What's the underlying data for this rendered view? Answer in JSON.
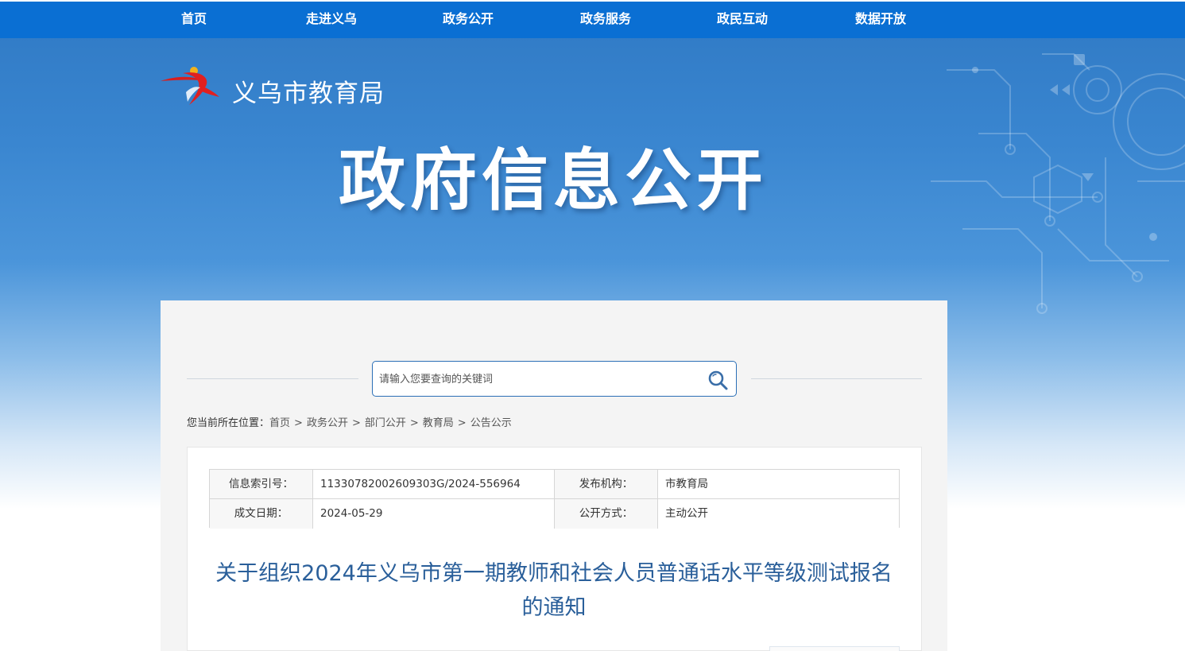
{
  "nav": {
    "items": [
      "首页",
      "走进义乌",
      "政务公开",
      "政务服务",
      "政民互动",
      "数据开放"
    ]
  },
  "header": {
    "logo_text": "义乌市教育局",
    "banner_title": "政府信息公开"
  },
  "search": {
    "placeholder": "请输入您要查询的关键词"
  },
  "breadcrumb": {
    "prefix": "您当前所在位置：",
    "items": [
      "首页",
      "政务公开",
      "部门公开",
      "教育局",
      "公告公示"
    ],
    "separator": ">"
  },
  "meta": {
    "index_label": "信息索引号：",
    "index_value": "11330782002609303G/2024-556964",
    "publisher_label": "发布机构：",
    "publisher_value": "市教育局",
    "date_label": "成文日期：",
    "date_value": "2024-05-29",
    "mode_label": "公开方式：",
    "mode_value": "主动公开"
  },
  "document": {
    "title": "关于组织2024年义乌市第一期教师和社会人员普通话水平等级测试报名的通知"
  },
  "colors": {
    "nav_bg": "#0a6fd3",
    "title_blue": "#2a5f9a",
    "search_border": "#2b6fb6"
  }
}
